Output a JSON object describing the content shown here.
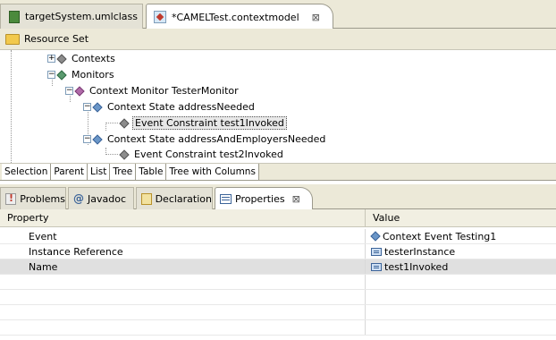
{
  "editor_tabs": [
    {
      "label": "targetSystem.umlclass",
      "icon": "uml-class-icon"
    },
    {
      "label": "*CAMELTest.contextmodel",
      "icon": "context-model-icon",
      "close": "⊠"
    }
  ],
  "resource_set": {
    "label": "Resource Set",
    "icon": "folder-icon"
  },
  "tree": {
    "contexts": "Contexts",
    "monitors": "Monitors",
    "monitor": "Context Monitor TesterMonitor",
    "state1": "Context State addressNeeded",
    "constraint1": "Event Constraint test1Invoked",
    "state2": "Context State addressAndEmployersNeeded",
    "constraint2": "Event Constraint test2Invoked"
  },
  "viewer_tabs": [
    "Selection",
    "Parent",
    "List",
    "Tree",
    "Table",
    "Tree with Columns"
  ],
  "view_tabs": [
    {
      "label": "Problems",
      "icon": "problems-icon"
    },
    {
      "label": "Javadoc",
      "icon": "javadoc-icon"
    },
    {
      "label": "Declaration",
      "icon": "declaration-icon"
    },
    {
      "label": "Properties",
      "icon": "properties-icon",
      "close": "⊠"
    }
  ],
  "properties": {
    "headers": {
      "property": "Property",
      "value": "Value"
    },
    "rows": [
      {
        "property": "Event",
        "value": "Context Event Testing1",
        "value_icon": "diamond-icon"
      },
      {
        "property": "Instance Reference",
        "value": "testerInstance",
        "value_icon": "text-value-icon"
      },
      {
        "property": "Name",
        "value": "test1Invoked",
        "value_icon": "text-value-icon"
      }
    ]
  }
}
